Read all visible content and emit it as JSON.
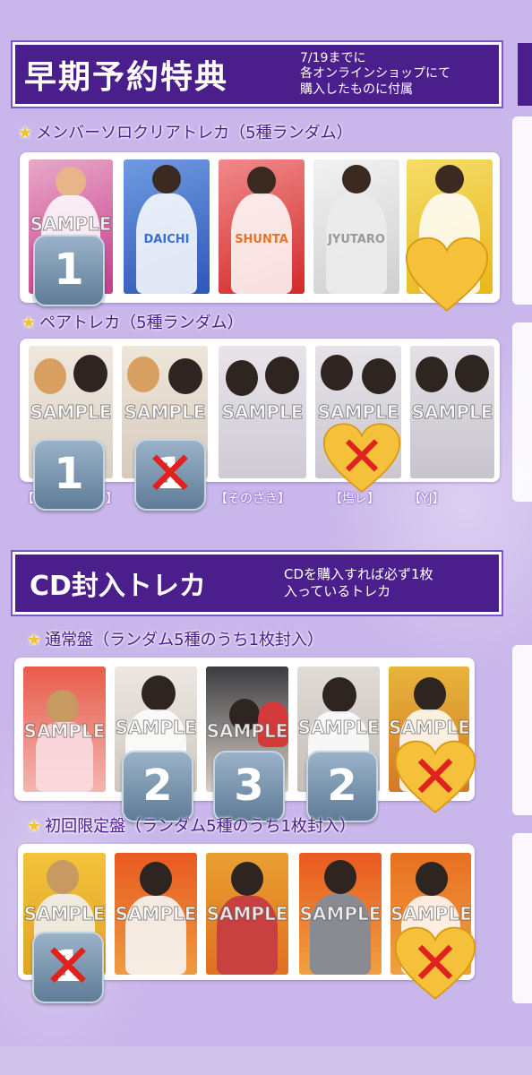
{
  "sections": {
    "early": {
      "title": "早期予約特典",
      "note": "7/19までに\n各オンラインショップにて\n購入したものに付属",
      "clear_cards": {
        "label": "メンバーソロクリアトレカ（5種ランダム）",
        "names": [
          "",
          "DAICHI",
          "SHUNTA",
          "JYUTARO",
          ""
        ]
      },
      "pair_cards": {
        "label": "ペアトレカ（5種ランダム）",
        "tags": [
          "【",
          "】",
          "【そのざき】",
          "【塩レ】",
          "【YJ】"
        ]
      }
    },
    "cd": {
      "title": "CD封入トレカ",
      "note": "CDを購入すれば必ず1枚\n入っているトレカ",
      "regular": {
        "label": "通常盤（ランダム5種のうち1枚封入）"
      },
      "limited": {
        "label": "初回限定盤（ランダム5種のうち1枚封入）"
      }
    }
  },
  "watermark": "SAMPLE",
  "badges": [
    "1",
    "1",
    "1",
    "2",
    "3",
    "2",
    "1"
  ],
  "marks": {
    "cross": "✕",
    "star": "★"
  },
  "colors": {
    "banner": "#4a1f8c",
    "background": "#c9b6ea",
    "cross": "#e0221e",
    "heart": "#f6c13a"
  }
}
